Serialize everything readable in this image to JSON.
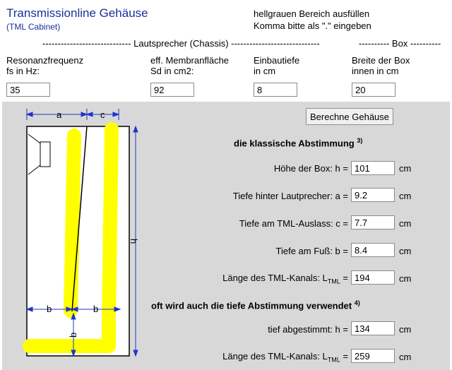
{
  "header": {
    "title": "Transmissionline Gehäuse",
    "subtitle": "(TML Cabinet)",
    "note_line1": "hellgrauen Bereich ausfüllen",
    "note_line2": "Komma bitte als \".\" eingeben"
  },
  "section_headers": {
    "speaker": "----------------------------- Lautsprecher (Chassis) -----------------------------",
    "box": "---------- Box ----------"
  },
  "inputs": [
    {
      "label1": "Resonanzfrequenz",
      "label2": "fs in Hz:",
      "value": "35"
    },
    {
      "label1": "eff. Membranfläche",
      "label2": "Sd in cm2:",
      "value": "92"
    },
    {
      "label1": "Einbautiefe",
      "label2": "in cm",
      "value": "8"
    },
    {
      "label1": "Breite der Box",
      "label2": "innen in cm",
      "value": "20"
    }
  ],
  "calculate_button": "Berechne Gehäuse",
  "classic": {
    "heading": "die klassische Abstimmung",
    "footnote": "3)",
    "rows": [
      {
        "label": "Höhe der Box: h =",
        "value": "101",
        "unit": "cm"
      },
      {
        "label": "Tiefe hinter Lautprecher: a =",
        "value": "9.2",
        "unit": "cm"
      },
      {
        "label": "Tiefe am TML-Auslass: c =",
        "value": "7.7",
        "unit": "cm"
      },
      {
        "label": "Tiefe am Fuß: b =",
        "value": "8.4",
        "unit": "cm"
      }
    ],
    "length_label": "Länge des TML-Kanals: L",
    "length_sub": "TML",
    "length_eq": "=",
    "length_value": "194",
    "length_unit": "cm"
  },
  "deep": {
    "heading": "oft wird auch die tiefe Abstimmung verwendet",
    "footnote": "4)",
    "tuned_label": "tief abgestimmt: h =",
    "tuned_value": "134",
    "tuned_unit": "cm",
    "length_label": "Länge des TML-Kanals: L",
    "length_sub": "TML",
    "length_eq": "=",
    "length_value": "259",
    "length_unit": "cm"
  },
  "diagram": {
    "label_a": "a",
    "label_b": "b",
    "label_c": "c",
    "label_h": "h",
    "dimension_color": "#2233cc",
    "fill_color": "#ffff00"
  }
}
